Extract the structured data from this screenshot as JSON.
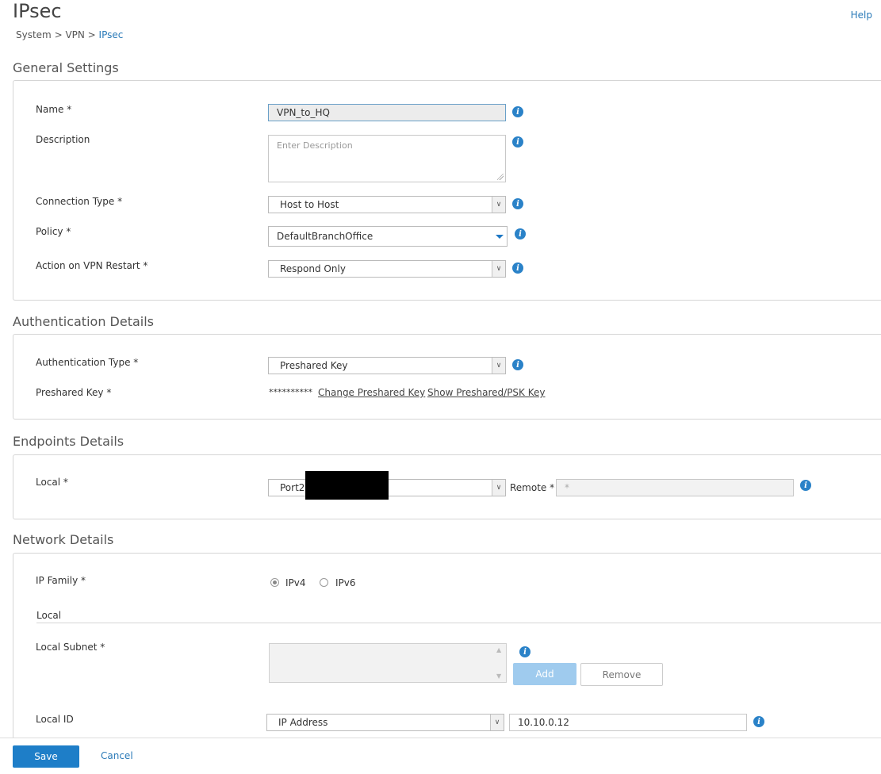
{
  "header": {
    "title": "IPsec",
    "breadcrumb": {
      "system": "System",
      "sep1": " > ",
      "vpn": "VPN",
      "sep2": " > ",
      "current": "IPsec"
    },
    "help": "Help"
  },
  "general": {
    "title": "General Settings",
    "name_label": "Name *",
    "name_value": "VPN_to_HQ",
    "description_label": "Description",
    "description_placeholder": "Enter Description",
    "connection_type_label": "Connection Type *",
    "connection_type_value": "Host to Host",
    "policy_label": "Policy *",
    "policy_value": "DefaultBranchOffice",
    "action_label": "Action on VPN Restart *",
    "action_value": "Respond Only"
  },
  "auth": {
    "title": "Authentication Details",
    "type_label": "Authentication Type *",
    "type_value": "Preshared Key",
    "psk_label": "Preshared Key *",
    "psk_masked": "**********",
    "change_psk": "Change Preshared Key",
    "show_psk": "Show Preshared/PSK Key"
  },
  "endpoints": {
    "title": "Endpoints Details",
    "local_label": "Local *",
    "local_value": "Port2",
    "remote_label": "Remote *",
    "remote_placeholder": "*"
  },
  "network": {
    "title": "Network Details",
    "ip_family_label": "IP Family *",
    "ipv4": "IPv4",
    "ipv6": "IPv6",
    "ipv4_selected": true,
    "local_heading": "Local",
    "local_subnet_label": "Local Subnet *",
    "add": "Add",
    "remove": "Remove",
    "local_id_label": "Local ID",
    "local_id_type": "IP Address",
    "local_id_value": "10.10.0.12"
  },
  "footer": {
    "save": "Save",
    "cancel": "Cancel"
  },
  "icons": {
    "info": "i",
    "chevron": "∨"
  },
  "colors": {
    "accent": "#1e7ec8",
    "link": "#2a7ab8",
    "info_icon": "#2a82c8",
    "add_disabled": "#9fcbee"
  }
}
